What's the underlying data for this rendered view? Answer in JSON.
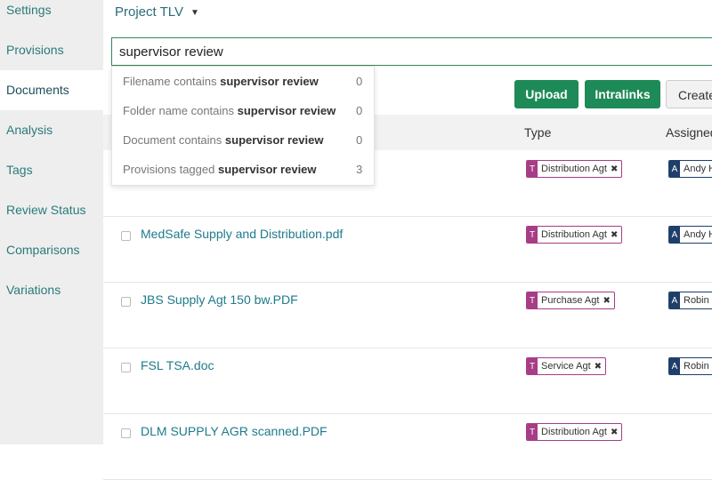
{
  "sidebar": {
    "items": [
      {
        "label": "Settings"
      },
      {
        "label": "Provisions"
      },
      {
        "label": "Documents"
      },
      {
        "label": "Analysis"
      },
      {
        "label": "Tags"
      },
      {
        "label": "Review Status"
      },
      {
        "label": "Comparisons"
      },
      {
        "label": "Variations"
      }
    ]
  },
  "header": {
    "project": "Project TLV"
  },
  "search": {
    "value": "supervisor review"
  },
  "suggestions": [
    {
      "prefix": "Filename contains",
      "term": "supervisor review",
      "count": "0"
    },
    {
      "prefix": "Folder name contains",
      "term": "supervisor review",
      "count": "0"
    },
    {
      "prefix": "Document contains",
      "term": "supervisor review",
      "count": "0"
    },
    {
      "prefix": "Provisions tagged",
      "term": "supervisor review",
      "count": "3"
    }
  ],
  "toolbar": {
    "upload": "Upload",
    "intralinks": "Intralinks",
    "create": "Create"
  },
  "table": {
    "columns": {
      "type": "Type",
      "assigned": "Assigned"
    },
    "rows": [
      {
        "filename": "",
        "type_badge": "T",
        "type": "Distribution Agt",
        "assignee_badge": "A",
        "assignee": "Andy H"
      },
      {
        "filename": "MedSafe Supply and Distribution.pdf",
        "type_badge": "T",
        "type": "Distribution Agt",
        "assignee_badge": "A",
        "assignee": "Andy H"
      },
      {
        "filename": "JBS Supply Agt 150 bw.PDF",
        "type_badge": "T",
        "type": "Purchase Agt",
        "assignee_badge": "A",
        "assignee": "Robin"
      },
      {
        "filename": "FSL TSA.doc",
        "type_badge": "T",
        "type": "Service Agt",
        "assignee_badge": "A",
        "assignee": "Robin"
      },
      {
        "filename": "DLM SUPPLY AGR scanned.PDF",
        "type_badge": "T",
        "type": "Distribution Agt",
        "assignee_badge": "",
        "assignee": ""
      }
    ]
  },
  "colors": {
    "primary_button": "#1e8a57",
    "type_tag": "#a63d86",
    "assignee_tag": "#1f3f6b",
    "link": "#1f7a8c"
  }
}
